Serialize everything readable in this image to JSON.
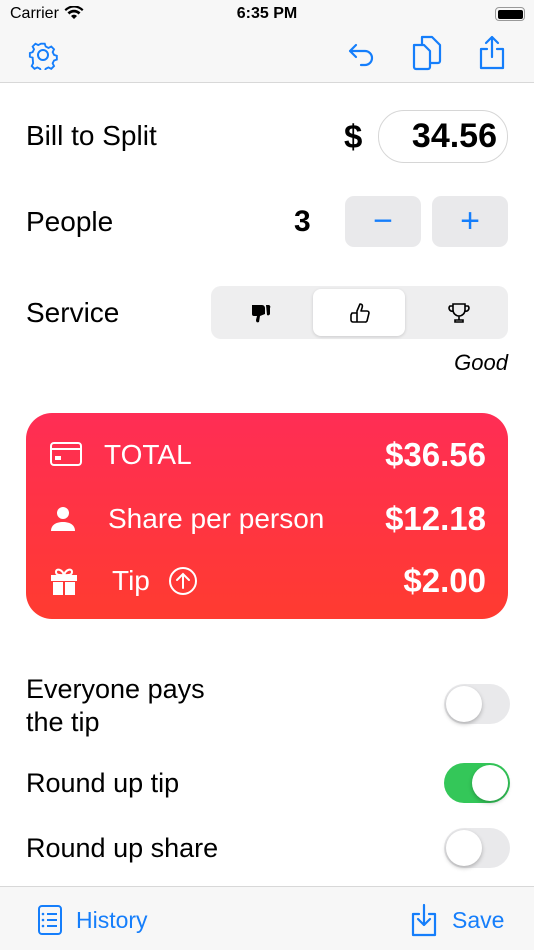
{
  "status": {
    "carrier": "Carrier",
    "time": "6:35 PM"
  },
  "bill": {
    "label": "Bill to Split",
    "currency": "$",
    "value": "34.56"
  },
  "people": {
    "label": "People",
    "count": "3",
    "decrement": "−",
    "increment": "+"
  },
  "service": {
    "label": "Service",
    "options": [
      "poor",
      "good",
      "excellent"
    ],
    "selected": "good",
    "selected_label": "Good"
  },
  "summary": {
    "total_label": "TOTAL",
    "total": "$36.56",
    "share_label": "Share per person",
    "share": "$12.18",
    "tip_label": "Tip",
    "tip": "$2.00",
    "gradient": [
      "#ff2d55",
      "#ff3b30"
    ]
  },
  "options": [
    {
      "label_line1": "Everyone pays",
      "label_line2": "the tip",
      "on": false
    },
    {
      "label": "Round up tip",
      "on": true
    },
    {
      "label": "Round up share",
      "on": false
    }
  ],
  "bottom": {
    "history": "History",
    "save": "Save"
  },
  "colors": {
    "accent": "#157efb",
    "toggle_on": "#34c759"
  }
}
